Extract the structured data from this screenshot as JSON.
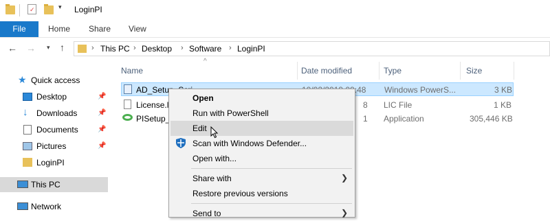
{
  "window": {
    "title": "LoginPI"
  },
  "ribbon": {
    "tabs": [
      "File",
      "Home",
      "Share",
      "View"
    ]
  },
  "address": {
    "crumbs": [
      "This PC",
      "Desktop",
      "Software",
      "LoginPI"
    ]
  },
  "nav": {
    "items": [
      {
        "label": "Quick access",
        "icon": "star-icon"
      },
      {
        "label": "Desktop",
        "icon": "desktop-icon",
        "pinned": true
      },
      {
        "label": "Downloads",
        "icon": "download-icon",
        "pinned": true
      },
      {
        "label": "Documents",
        "icon": "documents-icon",
        "pinned": true
      },
      {
        "label": "Pictures",
        "icon": "pictures-icon",
        "pinned": true
      },
      {
        "label": "LoginPI",
        "icon": "folder-icon"
      },
      {
        "label": "This PC",
        "icon": "computer-icon",
        "selected": true
      },
      {
        "label": "Network",
        "icon": "network-icon"
      }
    ]
  },
  "columns": {
    "name": "Name",
    "date": "Date modified",
    "type": "Type",
    "size": "Size"
  },
  "files": [
    {
      "name": "AD_Setup_Scri",
      "date": "10/02/2019 09:48",
      "type": "Windows PowerS...",
      "size": "3 KB",
      "selected": true
    },
    {
      "name": "License.li",
      "date": "8",
      "type": "LIC File",
      "size": "1 KB"
    },
    {
      "name": "PISetup_",
      "date": "1",
      "type": "Application",
      "size": "305,446 KB"
    }
  ],
  "context_menu": {
    "items": [
      "Open",
      "Run with PowerShell",
      "Edit",
      "Scan with Windows Defender...",
      "Open with...",
      "Share with",
      "Restore previous versions",
      "Send to"
    ]
  },
  "colors": {
    "accent": "#1979ca",
    "selection": "#cce8ff",
    "menu_bg": "#f2f2f2",
    "menu_highlight": "#dadada"
  }
}
